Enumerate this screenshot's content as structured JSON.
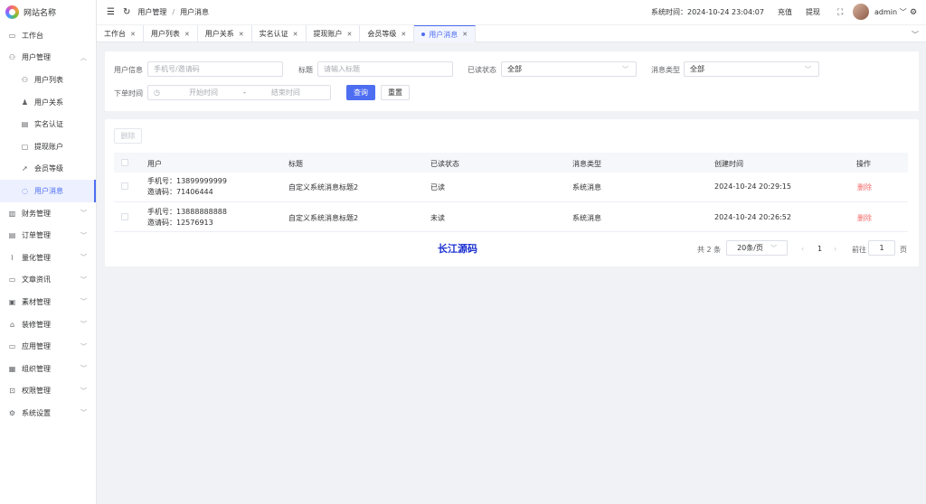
{
  "app": {
    "site_name": "网站名称"
  },
  "sidebar": {
    "items": [
      {
        "label": "工作台",
        "icon": "monitor-icon"
      },
      {
        "label": "用户管理",
        "icon": "user-icon",
        "expanded": true
      },
      {
        "label": "用户列表",
        "icon": "user-icon"
      },
      {
        "label": "用户关系",
        "icon": "user-group-icon"
      },
      {
        "label": "实名认证",
        "icon": "id-card-icon"
      },
      {
        "label": "提现账户",
        "icon": "folder-icon"
      },
      {
        "label": "会员等级",
        "icon": "rocket-icon"
      },
      {
        "label": "用户消息",
        "icon": "message-icon",
        "active": true
      },
      {
        "label": "财务管理",
        "icon": "finance-icon"
      },
      {
        "label": "订单管理",
        "icon": "order-icon"
      },
      {
        "label": "量化管理",
        "icon": "chart-icon"
      },
      {
        "label": "文章资讯",
        "icon": "article-icon"
      },
      {
        "label": "素材管理",
        "icon": "image-icon"
      },
      {
        "label": "装修管理",
        "icon": "shop-icon"
      },
      {
        "label": "应用管理",
        "icon": "app-icon"
      },
      {
        "label": "组织管理",
        "icon": "building-icon"
      },
      {
        "label": "权限管理",
        "icon": "lock-icon"
      },
      {
        "label": "系统设置",
        "icon": "gear-icon"
      }
    ]
  },
  "header": {
    "breadcrumb": [
      "用户管理",
      "用户消息"
    ],
    "system_time": "系统时间：2024-10-24 23:04:07",
    "recharge": "充值",
    "withdraw": "提现",
    "username": "admin"
  },
  "tabs": [
    {
      "label": "工作台"
    },
    {
      "label": "用户列表"
    },
    {
      "label": "用户关系"
    },
    {
      "label": "实名认证"
    },
    {
      "label": "提现账户"
    },
    {
      "label": "会员等级"
    },
    {
      "label": "用户消息",
      "active": true
    }
  ],
  "filters": {
    "user_info_label": "用户信息",
    "user_info_placeholder": "手机号/邀请码",
    "title_label": "标题",
    "title_placeholder": "请输入标题",
    "read_status_label": "已读状态",
    "read_status_value": "全部",
    "msg_type_label": "消息类型",
    "msg_type_value": "全部",
    "order_time_label": "下单时间",
    "start_placeholder": "开始时间",
    "range_sep": "-",
    "end_placeholder": "结束时间",
    "query_label": "查询",
    "reset_label": "重置"
  },
  "table": {
    "delete_label": "删除",
    "columns": [
      "用户",
      "标题",
      "已读状态",
      "消息类型",
      "创建时间",
      "操作"
    ],
    "rows": [
      {
        "phone": "手机号：13899999999",
        "invite": "邀请码：71406444",
        "title": "自定义系统消息标题2",
        "status": "已读",
        "type": "系统消息",
        "created": "2024-10-24 20:29:15",
        "action": "删除"
      },
      {
        "phone": "手机号：13888888888",
        "invite": "邀请码：12576913",
        "title": "自定义系统消息标题2",
        "status": "未读",
        "type": "系统消息",
        "created": "2024-10-24 20:26:52",
        "action": "删除"
      }
    ]
  },
  "pagination": {
    "total": "共 2 条",
    "page_size": "20条/页",
    "current_page": "1",
    "goto_label": "前往",
    "goto_value": "1",
    "page_suffix": "页"
  },
  "watermark": "长江源码",
  "colors": {
    "primary": "#4e6ef2",
    "danger": "#f56c6c"
  }
}
